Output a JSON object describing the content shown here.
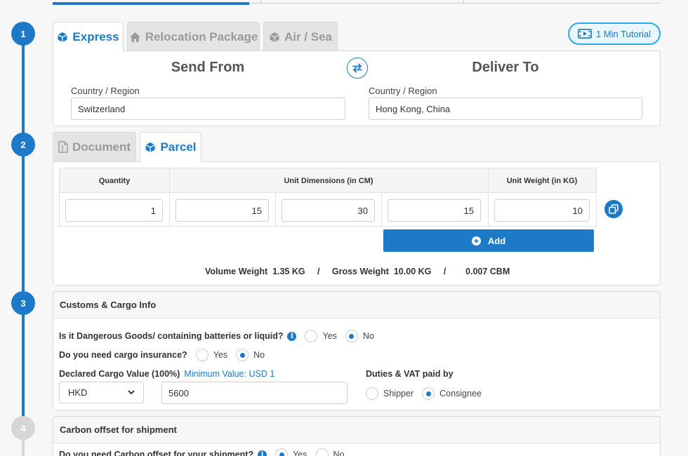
{
  "steps": [
    "1",
    "2",
    "3",
    "4"
  ],
  "shipping_tabs": [
    {
      "label": "Express",
      "active": true,
      "icon": "box-icon"
    },
    {
      "label": "Relocation Package",
      "active": false,
      "icon": "home-icon"
    },
    {
      "label": "Air / Sea",
      "active": false,
      "icon": "box-icon"
    }
  ],
  "tutorial": {
    "label": "1 Min Tutorial",
    "icon": "film-icon"
  },
  "route": {
    "from": {
      "heading": "Send From",
      "label": "Country / Region",
      "value": "Switzerland"
    },
    "to": {
      "heading": "Deliver To",
      "label": "Country / Region",
      "value": "Hong Kong, China"
    },
    "swap_icon": "swap-arrows-icon"
  },
  "package_tabs": [
    {
      "label": "Document",
      "active": false,
      "icon": "document-icon"
    },
    {
      "label": "Parcel",
      "active": true,
      "icon": "box-icon"
    }
  ],
  "parcel": {
    "headers": {
      "quantity": "Quantity",
      "dimensions": "Unit Dimensions (in CM)",
      "weight": "Unit Weight (in KG)"
    },
    "row": {
      "quantity": "1",
      "length": "15",
      "width": "30",
      "height": "15",
      "weight": "10"
    },
    "add_label": "Add",
    "copy_icon": "copy-icon"
  },
  "summary": {
    "volume_label": "Volume Weight",
    "volume_value": "1.35 KG",
    "sep": "/",
    "gross_label": "Gross Weight",
    "gross_value": "10.00 KG",
    "cbm": "0.007 CBM"
  },
  "customs": {
    "title": "Customs & Cargo Info",
    "dangerous_q": "Is it Dangerous Goods/ containing batteries or liquid?",
    "insurance_q": "Do you need cargo insurance?",
    "yes": "Yes",
    "no": "No",
    "dangerous_selected": "No",
    "insurance_selected": "No",
    "declared_label": "Declared Cargo Value (100%)",
    "min_value": "Minimum Value: USD 1",
    "currency": "HKD",
    "declared_value": "5600",
    "duties_label": "Duties & VAT paid by",
    "shipper": "Shipper",
    "consignee": "Consignee",
    "duties_selected": "Consignee"
  },
  "carbon": {
    "title": "Carbon offset for shipment",
    "question": "Do you need Carbon offset for your shipment?",
    "yes": "Yes",
    "no": "No",
    "selected": "Yes"
  },
  "colors": {
    "accent": "#1d7ac8",
    "tutorial_border": "#2aa9e8"
  }
}
